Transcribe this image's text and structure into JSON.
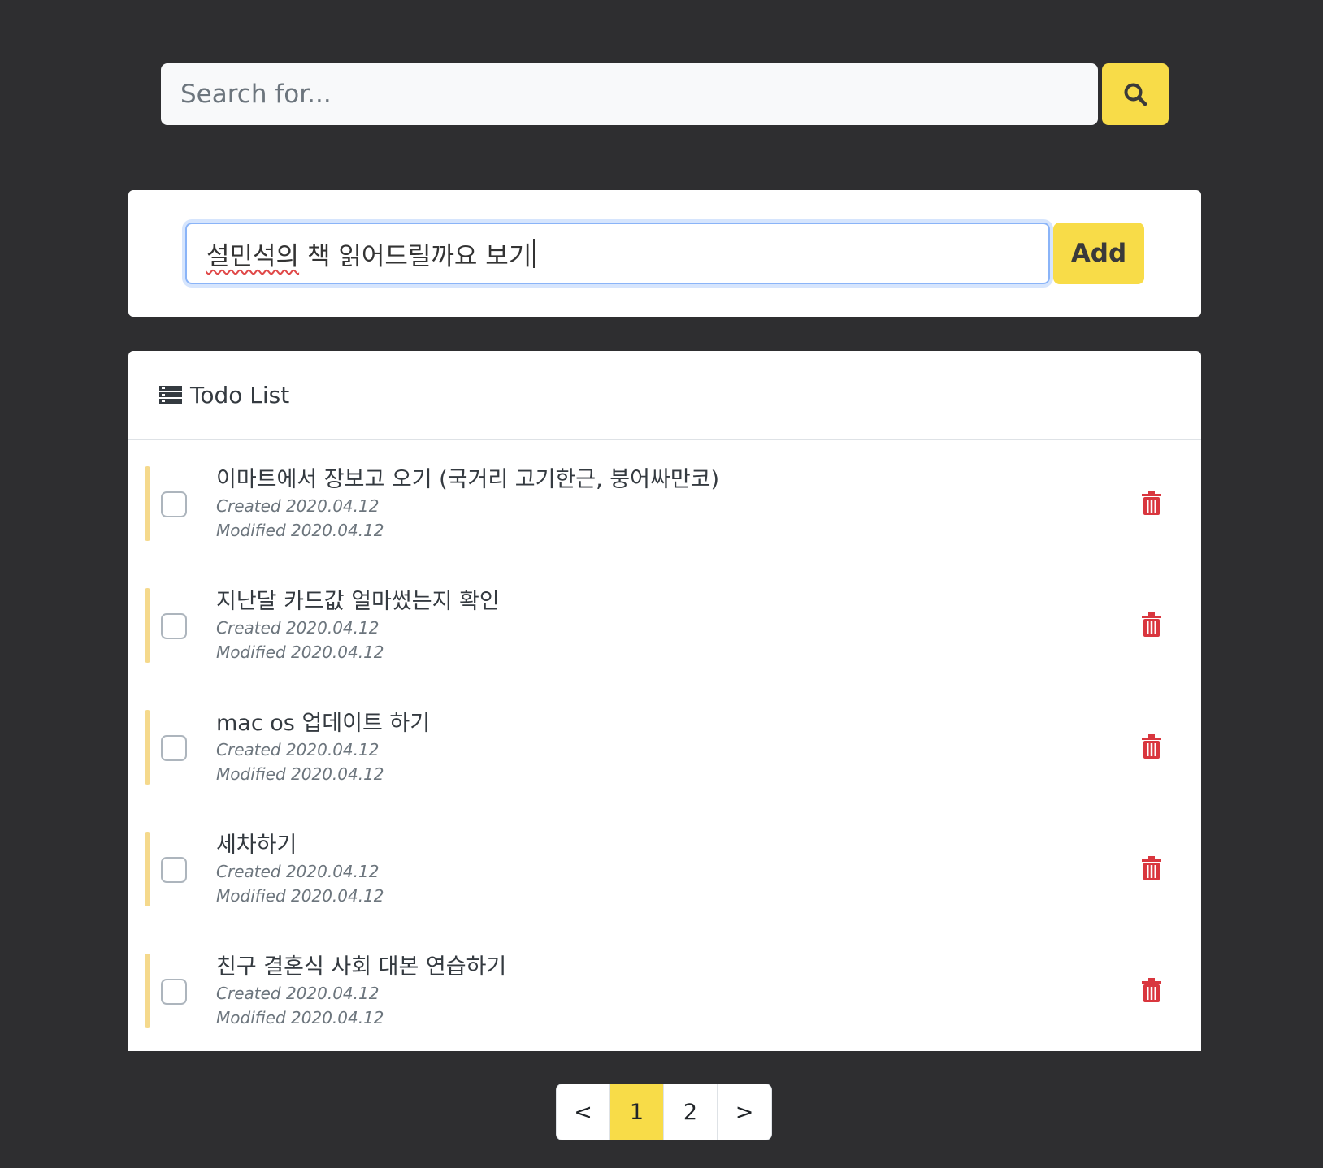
{
  "search": {
    "placeholder": "Search for..."
  },
  "add": {
    "value_underlined": "설민석의",
    "value_rest": " 책 읽어드릴까요 보기",
    "button_label": "Add"
  },
  "todo": {
    "header": "Todo List",
    "items": [
      {
        "title": "이마트에서 장보고 오기 (국거리 고기한근, 붕어싸만코)",
        "created": "Created 2020.04.12",
        "modified": "Modified 2020.04.12"
      },
      {
        "title": "지난달 카드값 얼마썼는지 확인",
        "created": "Created 2020.04.12",
        "modified": "Modified 2020.04.12"
      },
      {
        "title": "mac os 업데이트 하기",
        "created": "Created 2020.04.12",
        "modified": "Modified 2020.04.12"
      },
      {
        "title": "세차하기",
        "created": "Created 2020.04.12",
        "modified": "Modified 2020.04.12"
      },
      {
        "title": "친구 결혼식 사회 대본 연습하기",
        "created": "Created 2020.04.12",
        "modified": "Modified 2020.04.12"
      }
    ]
  },
  "pagination": {
    "prev": "<",
    "pages": [
      "1",
      "2"
    ],
    "active": "1",
    "next": ">"
  },
  "colors": {
    "accent": "#f8dc48",
    "background": "#2e2e30",
    "delete": "#d9363e",
    "item_bar": "#f5d98c"
  },
  "icons": {
    "search": "search-icon",
    "list": "list-icon",
    "delete": "trash-icon"
  }
}
